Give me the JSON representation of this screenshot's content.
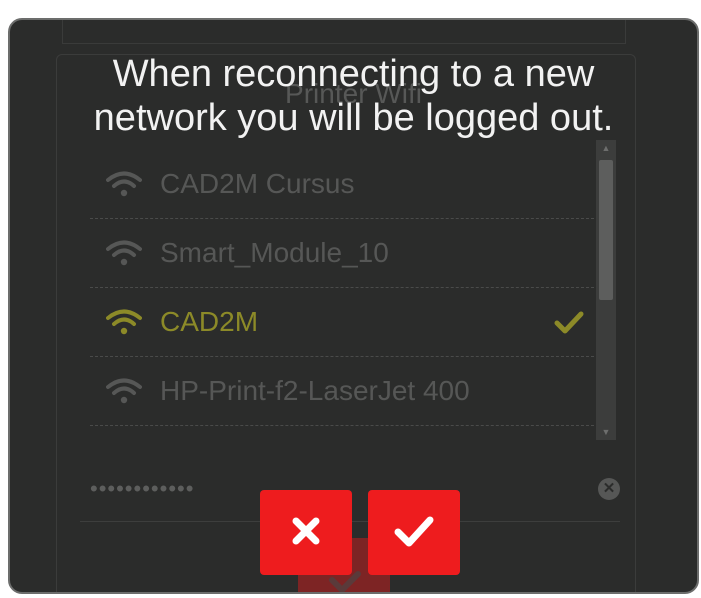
{
  "message": {
    "line1": "When reconnecting to a new",
    "line2": "network you will be logged out."
  },
  "underlay": {
    "title": "Printer Wifi",
    "networks": [
      {
        "name": "CAD2M Cursus",
        "active": false
      },
      {
        "name": "Smart_Module_10",
        "active": false
      },
      {
        "name": "CAD2M",
        "active": true
      },
      {
        "name": "HP-Print-f2-LaserJet 400",
        "active": false
      }
    ],
    "password_masked": "••••••••••••"
  },
  "icons": {
    "wifi": "wifi-icon",
    "selected": "checkmark-icon",
    "clear": "clear-input-icon",
    "cancel": "x-icon",
    "confirm": "checkmark-icon"
  },
  "colors": {
    "overlay_bg": "#2b2c2b",
    "button_red": "#ee1c1e",
    "active_network": "#8c8a28",
    "dim_text": "#565756"
  }
}
